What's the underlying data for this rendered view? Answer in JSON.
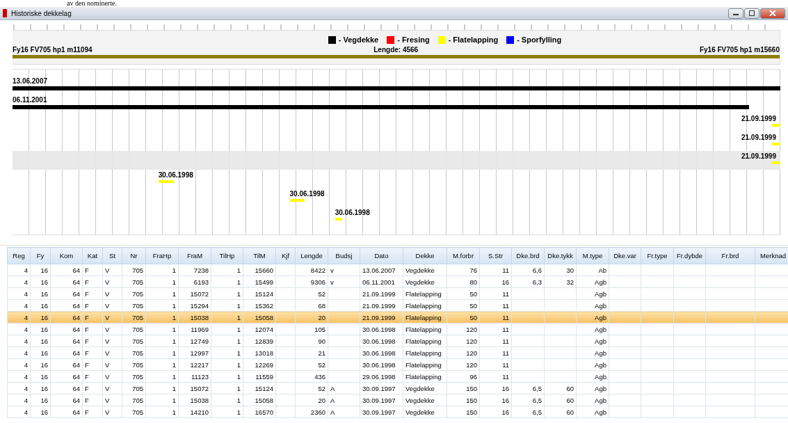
{
  "behind_text": "av den nominerte.",
  "window": {
    "title": "Historiske dekkelag"
  },
  "legend": [
    {
      "label": "- Vegdekke",
      "color": "#000000"
    },
    {
      "label": "- Fresing",
      "color": "#ff0000"
    },
    {
      "label": "- Flatelapping",
      "color": "#ffff00"
    },
    {
      "label": "- Sporfylling",
      "color": "#0000ff"
    }
  ],
  "road": {
    "start": "Fy16 FV705  hp1 m11094",
    "length": "Lengde: 4566",
    "end": "Fy16 FV705  hp1 m15660"
  },
  "timeline": [
    {
      "date": "13.06.2007",
      "kind": "vegdekke",
      "selected": false
    },
    {
      "date": "06.11.2001",
      "kind": "vegdekke",
      "selected": false
    },
    {
      "date": "21.09.1999",
      "kind": "flatelapping",
      "selected": false
    },
    {
      "date": "21.09.1999",
      "kind": "flatelapping",
      "selected": false
    },
    {
      "date": "21.09.1999",
      "kind": "flatelapping",
      "selected": true
    },
    {
      "date": "30.06.1998",
      "kind": "flatelapping",
      "selected": false
    },
    {
      "date": "30.06.1998",
      "kind": "flatelapping",
      "selected": false
    },
    {
      "date": "30.06.1998",
      "kind": "flatelapping",
      "selected": false
    }
  ],
  "table": {
    "columns": [
      "Reg",
      "Fy",
      "Kom",
      "Kat",
      "St",
      "Nr",
      "FraHp",
      "FraM",
      "TilHp",
      "TilM",
      "Kjf",
      "Lengde",
      "Budsj",
      "Dato",
      "Dekke",
      "M.forbr",
      "S.Str",
      "Dke.brd",
      "Dke.tykk",
      "M.type",
      "Dke.var",
      "Fr.type",
      "Fr.dybde",
      "Fr.brd",
      "Merknad"
    ],
    "rows": [
      {
        "selected": false,
        "cells": [
          "4",
          "16",
          "64",
          "F",
          "V",
          "705",
          "1",
          "7238",
          "1",
          "15660",
          null,
          "8422",
          "v",
          "13.06.2007",
          "Vegdekke",
          "76",
          "11",
          "6,6",
          "30",
          "Ab",
          null,
          null,
          null,
          null,
          null
        ]
      },
      {
        "selected": false,
        "cells": [
          "4",
          "16",
          "64",
          "F",
          "V",
          "705",
          "1",
          "6193",
          "1",
          "15499",
          null,
          "9306",
          "v",
          "06.11.2001",
          "Vegdekke",
          "80",
          "16",
          "6,3",
          "32",
          "Agb",
          null,
          null,
          null,
          null,
          null
        ]
      },
      {
        "selected": false,
        "cells": [
          "4",
          "16",
          "64",
          "F",
          "V",
          "705",
          "1",
          "15072",
          "1",
          "15124",
          null,
          "52",
          null,
          "21.09.1999",
          "Flatelapping",
          "50",
          "11",
          null,
          null,
          "Agb",
          null,
          null,
          null,
          null,
          null
        ]
      },
      {
        "selected": false,
        "cells": [
          "4",
          "16",
          "64",
          "F",
          "V",
          "705",
          "1",
          "15294",
          "1",
          "15362",
          null,
          "68",
          null,
          "21.09.1999",
          "Flatelapping",
          "50",
          "11",
          null,
          null,
          "Agb",
          null,
          null,
          null,
          null,
          null
        ]
      },
      {
        "selected": true,
        "cells": [
          "4",
          "16",
          "64",
          "F",
          "V",
          "705",
          "1",
          "15038",
          "1",
          "15058",
          null,
          "20",
          null,
          "21.09.1999",
          "Flatelapping",
          "50",
          "11",
          null,
          null,
          "Agb",
          null,
          null,
          null,
          null,
          null
        ]
      },
      {
        "selected": false,
        "cells": [
          "4",
          "16",
          "64",
          "F",
          "V",
          "705",
          "1",
          "11969",
          "1",
          "12074",
          null,
          "105",
          null,
          "30.06.1998",
          "Flatelapping",
          "120",
          "11",
          null,
          null,
          "Agb",
          null,
          null,
          null,
          null,
          null
        ]
      },
      {
        "selected": false,
        "cells": [
          "4",
          "16",
          "64",
          "F",
          "V",
          "705",
          "1",
          "12749",
          "1",
          "12839",
          null,
          "90",
          null,
          "30.06.1998",
          "Flatelapping",
          "120",
          "11",
          null,
          null,
          "Agb",
          null,
          null,
          null,
          null,
          null
        ]
      },
      {
        "selected": false,
        "cells": [
          "4",
          "16",
          "64",
          "F",
          "V",
          "705",
          "1",
          "12997",
          "1",
          "13018",
          null,
          "21",
          null,
          "30.06.1998",
          "Flatelapping",
          "120",
          "11",
          null,
          null,
          "Agb",
          null,
          null,
          null,
          null,
          null
        ]
      },
      {
        "selected": false,
        "cells": [
          "4",
          "16",
          "64",
          "F",
          "V",
          "705",
          "1",
          "12217",
          "1",
          "12269",
          null,
          "52",
          null,
          "30.06.1998",
          "Flatelapping",
          "120",
          "11",
          null,
          null,
          "Agb",
          null,
          null,
          null,
          null,
          null
        ]
      },
      {
        "selected": false,
        "cells": [
          "4",
          "16",
          "64",
          "F",
          "V",
          "705",
          "1",
          "11123",
          "1",
          "11559",
          null,
          "436",
          null,
          "29.06.1998",
          "Flatelapping",
          "96",
          "11",
          null,
          null,
          "Agb",
          null,
          null,
          null,
          null,
          null
        ]
      },
      {
        "selected": false,
        "cells": [
          "4",
          "16",
          "64",
          "F",
          "V",
          "705",
          "1",
          "15072",
          "1",
          "15124",
          null,
          "52",
          "A",
          "30.09.1997",
          "Vegdekke",
          "150",
          "16",
          "6,5",
          "60",
          "Agb",
          null,
          null,
          null,
          null,
          null
        ]
      },
      {
        "selected": false,
        "cells": [
          "4",
          "16",
          "64",
          "F",
          "V",
          "705",
          "1",
          "15038",
          "1",
          "15058",
          null,
          "20",
          "A",
          "30.09.1997",
          "Vegdekke",
          "150",
          "16",
          "6,5",
          "60",
          "Agb",
          null,
          null,
          null,
          null,
          null
        ]
      },
      {
        "selected": false,
        "cells": [
          "4",
          "16",
          "64",
          "F",
          "V",
          "705",
          "1",
          "14210",
          "1",
          "16570",
          null,
          "2360",
          "A",
          "30.09.1997",
          "Vegdekke",
          "150",
          "16",
          "6,5",
          "60",
          "Agb",
          null,
          null,
          null,
          null,
          null
        ]
      }
    ]
  }
}
